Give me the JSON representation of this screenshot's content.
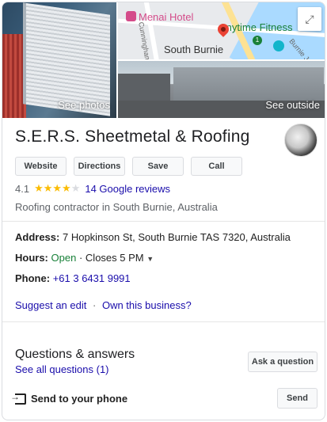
{
  "photos": {
    "see_photos": "See photos",
    "see_outside": "See outside"
  },
  "map": {
    "hotel_label": "Menai Hotel",
    "fitness_label": "Anytime Fitness",
    "town_label": "South Burnie",
    "street_left": "Cunningham",
    "street_right": "Burnie Jetty",
    "badge": "1"
  },
  "business": {
    "name": "S.E.R.S. Sheetmetal & Roofing",
    "rating": "4.1",
    "stars_filled": 4,
    "reviews": "14 Google reviews",
    "category": "Roofing contractor in South Burnie, Australia"
  },
  "actions": {
    "website": "Website",
    "directions": "Directions",
    "save": "Save",
    "call": "Call"
  },
  "info": {
    "address_label": "Address:",
    "address_value": "7 Hopkinson St, South Burnie TAS 7320, Australia",
    "hours_label": "Hours:",
    "hours_status": "Open",
    "hours_sep": "·",
    "hours_closes": "Closes 5 PM",
    "phone_label": "Phone:",
    "phone_value": "+61 3 6431 9991"
  },
  "links": {
    "suggest_edit": "Suggest an edit",
    "separator": "·",
    "own_business": "Own this business?"
  },
  "qa": {
    "title": "Questions & answers",
    "see_all": "See all questions (1)",
    "ask_button": "Ask a question"
  },
  "send": {
    "label": "Send to your phone",
    "button": "Send"
  },
  "colors": {
    "link": "#1a0dab",
    "open": "#188038",
    "star": "#fbbc04"
  }
}
